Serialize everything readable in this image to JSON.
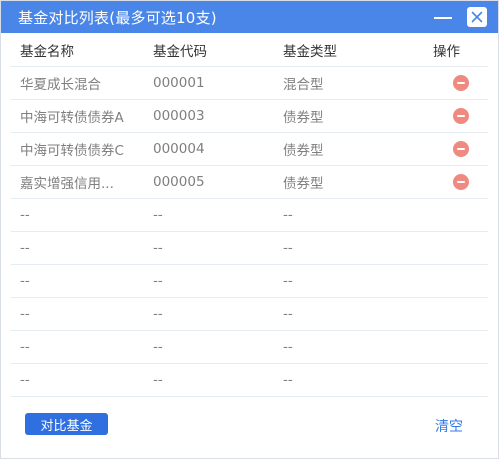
{
  "window": {
    "title": "基金对比列表(最多可选10支)",
    "accent_color": "#4a86e8",
    "minimize_icon": "minimize-icon",
    "close_icon": "close-icon"
  },
  "table": {
    "columns": [
      "基金名称",
      "基金代码",
      "基金类型",
      "操作"
    ],
    "rows": [
      {
        "name": "华夏成长混合",
        "code": "000001",
        "type": "混合型",
        "action_icon": "remove-icon"
      },
      {
        "name": "中海可转债债券A",
        "code": "000003",
        "type": "债券型",
        "action_icon": "remove-icon"
      },
      {
        "name": "中海可转债债券C",
        "code": "000004",
        "type": "债券型",
        "action_icon": "remove-icon"
      },
      {
        "name": "嘉实增强信用...",
        "code": "000005",
        "type": "债券型",
        "action_icon": "remove-icon"
      },
      {
        "name": "--",
        "code": "--",
        "type": "--"
      },
      {
        "name": "--",
        "code": "--",
        "type": "--"
      },
      {
        "name": "--",
        "code": "--",
        "type": "--"
      },
      {
        "name": "--",
        "code": "--",
        "type": "--"
      },
      {
        "name": "--",
        "code": "--",
        "type": "--"
      },
      {
        "name": "--",
        "code": "--",
        "type": "--"
      }
    ],
    "remove_icon_color": "#f0897f"
  },
  "footer": {
    "compare_label": "对比基金",
    "clear_label": "清空",
    "button_color": "#2f6fe0",
    "link_color": "#3478e6"
  }
}
